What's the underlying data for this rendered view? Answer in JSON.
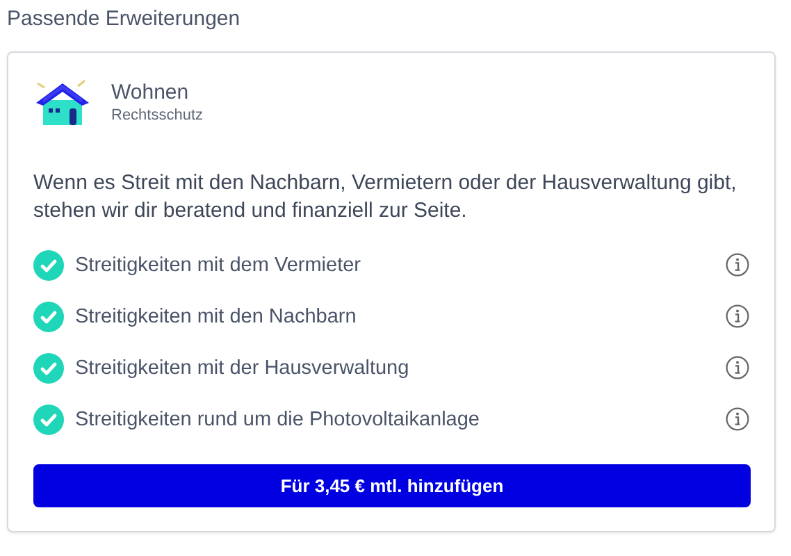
{
  "heading": "Passende Erweiterungen",
  "product": {
    "title": "Wohnen",
    "subtitle": "Rechtsschutz"
  },
  "description": "Wenn es Streit mit den Nachbarn, Vermietern oder der Hausverwaltung gibt, stehen wir dir beratend und finanziell zur Seite.",
  "features": [
    {
      "label": "Streitigkeiten mit dem Vermieter",
      "included": true
    },
    {
      "label": "Streitigkeiten mit den Nachbarn",
      "included": true
    },
    {
      "label": "Streitigkeiten mit der Hausverwaltung",
      "included": true
    },
    {
      "label": "Streitigkeiten rund um die Photovoltaikanlage",
      "included": true
    }
  ],
  "button": "Für 3,45 € mtl. hinzufügen"
}
